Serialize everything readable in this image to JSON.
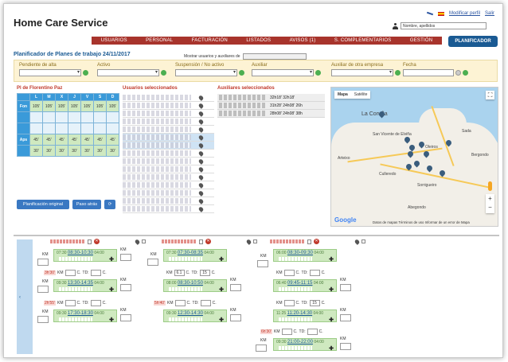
{
  "header": {
    "app_title": "Home Care Service",
    "link_profile": "Modificar perfil",
    "link_exit": "Salir",
    "search_value": "Nombre, apellidos"
  },
  "nav": {
    "items": [
      "USUARIOS",
      "PERSONAL",
      "FACTURACIÓN",
      "LISTADOS",
      "AVISOS (1)",
      "S. COMPLEMENTARIOS",
      "GESTIÓN"
    ],
    "active_button": "PLANIFICADOR"
  },
  "planner": {
    "title": "Planificador de Planes de trabajo 24/11/2017",
    "show_label": "Mostrar usuarios y auxiliares de"
  },
  "filters": {
    "pendiente": "Pendiente de alta",
    "activo": "Activo",
    "suspension": "Suspensión / No activo",
    "auxiliar": "Auxiliar",
    "auxiliar_otra": "Auxiliar de otra empresa",
    "fecha": "Fecha"
  },
  "sections": {
    "plan_label": "Pl de Florentino Paz",
    "users_label": "Usuarios seleccionados",
    "aux_label": "Auxiliares seleccionados"
  },
  "week_table": {
    "days": [
      "L",
      "M",
      "X",
      "J",
      "V",
      "S",
      "D"
    ],
    "rows": [
      {
        "label": "Fon",
        "cells": [
          "105'",
          "105'",
          "105'",
          "105'",
          "105'",
          "105'",
          "105'"
        ],
        "filled": true
      },
      {
        "label": "",
        "cells": [
          "",
          "",
          "",
          "",
          "",
          "",
          ""
        ],
        "filled": false
      },
      {
        "label": "",
        "cells": [
          "",
          "",
          "",
          "",
          "",
          "",
          ""
        ],
        "filled": false
      },
      {
        "label": "Aps",
        "cells": [
          "45'",
          "45'",
          "45'",
          "45'",
          "45'",
          "45'",
          "45'"
        ],
        "filled": true
      },
      {
        "label": "",
        "cells": [
          "30'",
          "30'",
          "30'",
          "30'",
          "30'",
          "30'",
          "30'"
        ],
        "filled": true
      }
    ]
  },
  "aux_hours": [
    "32h18' 32h18'",
    "31h28' 24h08' 26h",
    "28h08' 24h08' 38h"
  ],
  "buttons": {
    "original": "Planificación original",
    "back": "Paso atrás"
  },
  "map": {
    "tab_map": "Mapa",
    "tab_sat": "Satélite",
    "city_main": "La Coruña",
    "city_arteixo": "Arteixo",
    "city_culleredo": "Culleredo",
    "city_oleiros": "Oleiros",
    "city_sada": "Sada",
    "city_bergondo": "Bergondo",
    "city_sorrigueiro": "Sorrigueiro",
    "city_abegondo": "Abegondo",
    "city_vicente": "San Vicente de Elviña",
    "footer": "Datos de mapas   Términos de uso   Informar de un error de Mapa",
    "brand": "Google"
  },
  "schedule": {
    "km_label": "KM",
    "c_label": "C.",
    "td_label": "TD:",
    "columns": [
      {
        "visits": [
          {
            "prefix": "07:30",
            "time": "08:30-10:30",
            "suffix": "04:00"
          },
          {
            "prefix": "09:30",
            "time": "13:30-14:35",
            "suffix": "04:00"
          },
          {
            "prefix": "09:30",
            "time": "17:30-18:30",
            "suffix": "04:00"
          }
        ],
        "gaps": [
          "3h'30'",
          "2h'55'"
        ]
      },
      {
        "visits": [
          {
            "prefix": "07:30",
            "time": "07:30-08:35",
            "suffix": "04:00"
          },
          {
            "prefix": "08:00",
            "time": "08:30-10:50",
            "suffix": "04:00"
          },
          {
            "prefix": "09:30",
            "time": "12:30-14:30",
            "suffix": "04:00"
          }
        ],
        "km_value": "6.1",
        "td_value": "15",
        "gaps": [
          "5h'40'"
        ]
      },
      {
        "visits": [
          {
            "prefix": "06:00",
            "time": "08:30-09:30",
            "suffix": "04:00"
          },
          {
            "prefix": "06:40",
            "time": "09:45-11:15",
            "suffix": "04:00"
          },
          {
            "prefix": "11:25",
            "time": "11:20-14:30",
            "suffix": "04:00"
          },
          {
            "prefix": "09:30",
            "time": "21:00-22:00",
            "suffix": "04:00"
          }
        ],
        "td_value": "15",
        "gaps": [
          "6h'30'"
        ]
      }
    ]
  }
}
